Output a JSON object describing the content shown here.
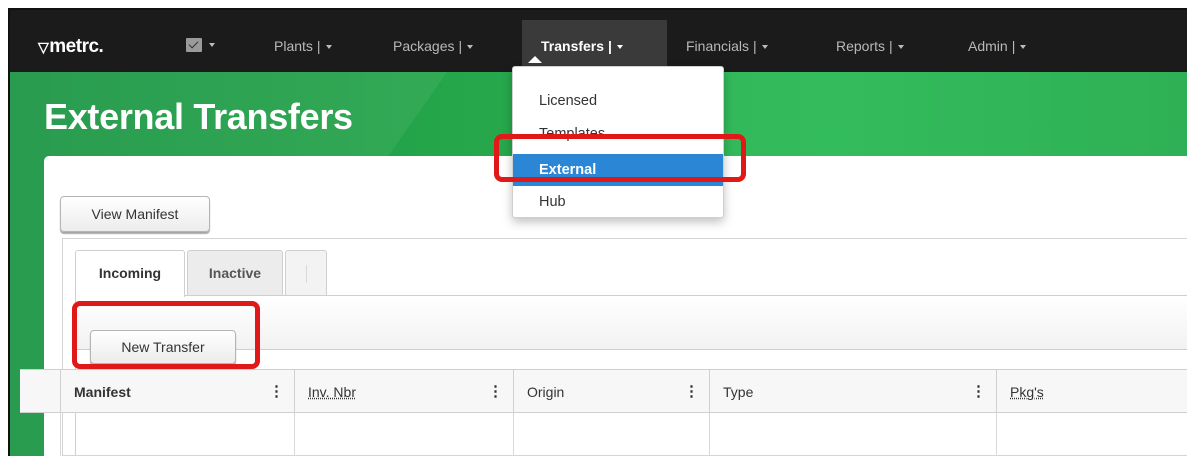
{
  "navbar": {
    "logo": "metrc.",
    "logo_icon": "checkmark-v-icon",
    "mail_icon": "envelope-icon",
    "items": [
      {
        "label": "Plants",
        "sep": "|"
      },
      {
        "label": "Packages",
        "sep": "|"
      },
      {
        "label": "Transfers",
        "sep": "|"
      },
      {
        "label": "Financials",
        "sep": "|"
      },
      {
        "label": "Reports",
        "sep": "|"
      },
      {
        "label": "Admin",
        "sep": "|"
      }
    ]
  },
  "dropdown": {
    "items": [
      "Licensed",
      "Templates",
      "External",
      "Hub"
    ],
    "active": "External",
    "active_color": "#2c86d6"
  },
  "page": {
    "title": "External Transfers",
    "banner_color": "#28b150"
  },
  "toolbar": {
    "view_manifest_label": "View Manifest",
    "new_transfer_label": "New Transfer"
  },
  "tabs": [
    "Incoming",
    "Inactive",
    ""
  ],
  "table": {
    "columns": [
      "Manifest",
      "Inv. Nbr",
      "Origin",
      "Type",
      "Pkg's"
    ],
    "column_menu_icon": "vertical-dots-icon"
  },
  "highlight_color": "#e11818"
}
